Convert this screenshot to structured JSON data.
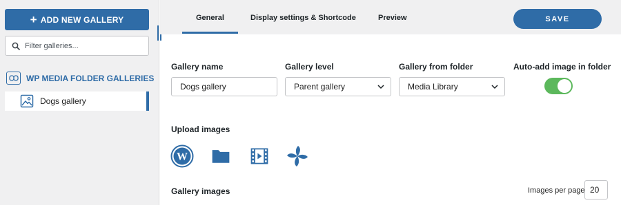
{
  "sidebar": {
    "add_button": {
      "icon": "plus-icon",
      "label": "ADD NEW GALLERY"
    },
    "filter": {
      "icon": "search-icon",
      "placeholder": "Filter galleries..."
    },
    "section": {
      "icon": "wp-media-folder-logo-icon",
      "title": "WP MEDIA FOLDER GALLERIES"
    },
    "galleries": [
      {
        "icon": "image-icon",
        "label": "Dogs gallery",
        "selected": true
      }
    ]
  },
  "tabs": [
    {
      "label": "General",
      "active": true
    },
    {
      "label": "Display settings & Shortcode",
      "active": false
    },
    {
      "label": "Preview",
      "active": false
    }
  ],
  "save_button": {
    "label": "SAVE"
  },
  "form": {
    "gallery_name": {
      "label": "Gallery name",
      "value": "Dogs gallery"
    },
    "gallery_level": {
      "label": "Gallery level",
      "value": "Parent gallery"
    },
    "gallery_folder": {
      "label": "Gallery from folder",
      "value": "Media Library"
    },
    "auto_add": {
      "label": "Auto-add image in folder",
      "enabled": true
    }
  },
  "upload": {
    "label": "Upload images",
    "sources": [
      "wordpress-icon",
      "folder-icon",
      "video-film-icon",
      "pinwheel-icon"
    ]
  },
  "gallery_images": {
    "label": "Gallery images",
    "per_page_label": "Images per page",
    "per_page_value": "20"
  },
  "colors": {
    "accent": "#2f6ca7",
    "toggle_on": "#5cb85c",
    "sidebar_bg": "#f0f0f1"
  }
}
